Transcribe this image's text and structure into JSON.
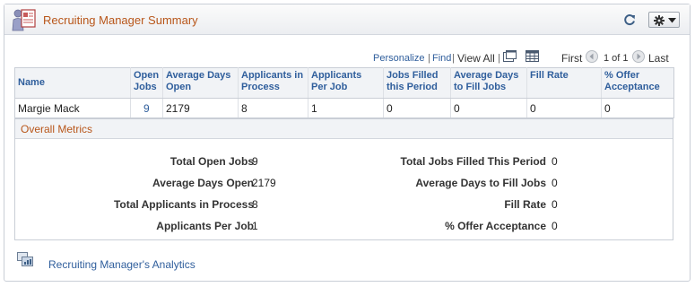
{
  "pagelet": {
    "title": "Recruiting Manager Summary"
  },
  "grid_nav": {
    "personalize": "Personalize",
    "sep1": "|",
    "find": "Find",
    "sep2": "|",
    "view_all": "View All",
    "sep3": "|",
    "first": "First",
    "page_info": "1 of 1",
    "last": "Last"
  },
  "table": {
    "headers": [
      "Name",
      "Open Jobs",
      "Average Days Open",
      "Applicants in Process",
      "Applicants Per Job",
      "Jobs Filled this Period",
      "Average Days to Fill Jobs",
      "Fill Rate",
      "% Offer Acceptance"
    ],
    "rows": [
      [
        "Margie Mack",
        "9",
        "2179",
        "8",
        "1",
        "0",
        "0",
        "0",
        "0"
      ]
    ]
  },
  "metrics": {
    "title": "Overall Metrics",
    "left": [
      {
        "label": "Total Open Jobs",
        "value": "9"
      },
      {
        "label": "Average Days Open",
        "value": "2179"
      },
      {
        "label": "Total Applicants in Process",
        "value": "8"
      },
      {
        "label": "Applicants Per Job",
        "value": "1"
      }
    ],
    "right": [
      {
        "label": "Total Jobs Filled This Period",
        "value": "0"
      },
      {
        "label": "Average Days to Fill Jobs",
        "value": "0"
      },
      {
        "label": "Fill Rate",
        "value": "0"
      },
      {
        "label": "% Offer Acceptance",
        "value": "0"
      }
    ]
  },
  "footer": {
    "analytics_link": "Recruiting Manager's Analytics"
  },
  "colors": {
    "title_orange": "#b8561a",
    "link_blue": "#2f5e9c",
    "header_bg": "#f1f3f6"
  }
}
